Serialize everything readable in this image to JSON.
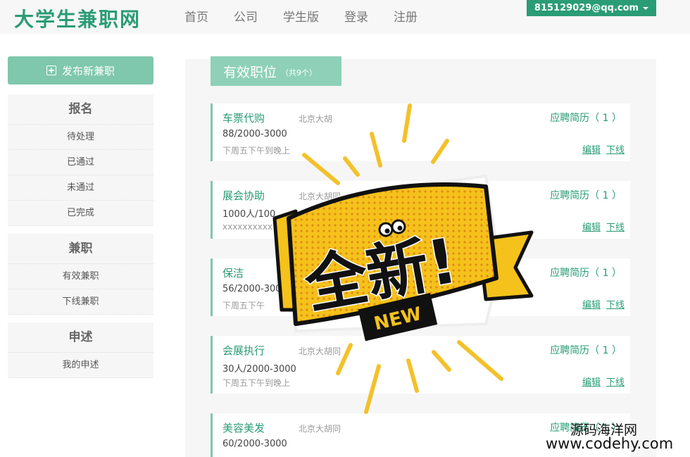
{
  "header": {
    "logo": "大学生兼职网",
    "nav": [
      "首页",
      "公司",
      "学生版",
      "登录",
      "注册"
    ],
    "user_email": "815129029@qq.com"
  },
  "sidebar": {
    "post_button": "发布新兼职",
    "groups": [
      {
        "title": "报名",
        "items": [
          "待处理",
          "已通过",
          "未通过",
          "已完成"
        ]
      },
      {
        "title": "兼职",
        "items": [
          "有效兼职",
          "下线兼职"
        ]
      },
      {
        "title": "申述",
        "items": [
          "我的申述"
        ]
      }
    ]
  },
  "main": {
    "title": "有效职位",
    "count": "（共9个）",
    "jobs": [
      {
        "title": "车票代购",
        "location": "北京大胡",
        "pay": "88/2000-3000",
        "time": "下周五下午到晚上",
        "resume": "应聘简历（ 1 ）"
      },
      {
        "title": "展会协助",
        "location": "北京大胡同",
        "pay": "1000人/100",
        "time": "xxxxxxxxxx",
        "resume": "应聘简历（ 1 ）"
      },
      {
        "title": "保洁",
        "location": "",
        "pay": "56/2000-300",
        "time": "下周五下午",
        "resume": "应聘简历（ 1 ）"
      },
      {
        "title": "会展执行",
        "location": "北京大胡同",
        "pay": "30人/2000-3000",
        "time": "下周五下午到晚上",
        "resume": "应聘简历（ 1 ）"
      },
      {
        "title": "美容美发",
        "location": "北京大胡同",
        "pay": "60/2000-3000",
        "time": "",
        "resume": "应聘简历（ 1 ）"
      }
    ],
    "edit_label": "编辑",
    "offline_label": "下线"
  },
  "sticker": {
    "big_text": "全新!",
    "small_text": "NEW"
  },
  "watermark": {
    "line1": "源码海洋网",
    "line2": "www.codehy.com"
  },
  "colors": {
    "accent": "#2a9c76",
    "accent_light": "#7fc7ad",
    "sticker_yellow": "#f5c21b"
  }
}
